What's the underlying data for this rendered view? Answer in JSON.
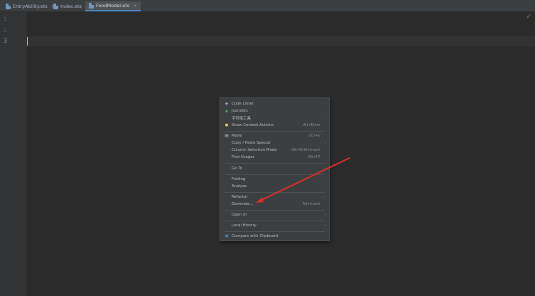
{
  "tabs": [
    {
      "label": "EntryAbility.ets",
      "close": "×"
    },
    {
      "label": "Index.ets",
      "close": "×"
    },
    {
      "label": "FoodModel.ets",
      "close": "×"
    }
  ],
  "status_check": "✓",
  "line_numbers": [
    "1",
    "2",
    "3"
  ],
  "context_menu": {
    "items": [
      {
        "label": "Code Linter",
        "arrow": "›",
        "icon": "◆"
      },
      {
        "label": "Json2ets",
        "icon": "▲"
      },
      {
        "label": "字符串工具",
        "arrow": "›"
      },
      {
        "label": "Show Context Actions",
        "shortcut": "Alt+Enter",
        "icon": "●"
      },
      {
        "label": "Paste",
        "shortcut": "Ctrl+V",
        "icon": "▤"
      },
      {
        "label": "Copy / Paste Special",
        "arrow": "›"
      },
      {
        "label": "Column Selection Mode",
        "shortcut": "Alt+Shift+Insert"
      },
      {
        "label": "Find Usages",
        "shortcut": "Alt+F7"
      },
      {
        "label": "Go To",
        "arrow": "›"
      },
      {
        "label": "Folding",
        "arrow": "›"
      },
      {
        "label": "Analyze",
        "arrow": "›"
      },
      {
        "label": "Refactor",
        "arrow": "›"
      },
      {
        "label": "Generate...",
        "shortcut": "Alt+Insert"
      },
      {
        "label": "Open In",
        "arrow": "›"
      },
      {
        "label": "Local History",
        "arrow": "›"
      },
      {
        "label": "Compare with Clipboard",
        "icon": "▣"
      }
    ]
  },
  "colors": {
    "annotation_arrow": "#d9302c",
    "accent": "#4a88c7"
  }
}
